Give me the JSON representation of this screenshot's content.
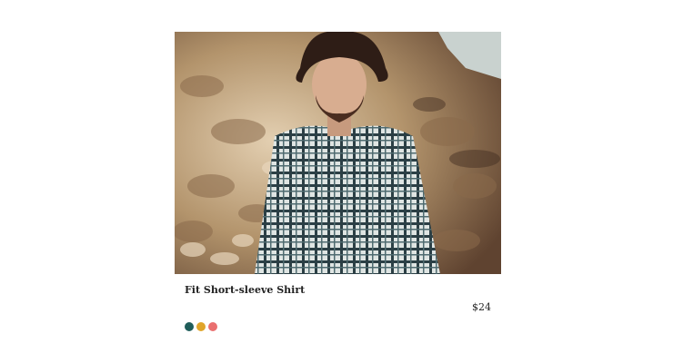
{
  "product": {
    "image_alt": "Young man with curly hair and beard wearing a plaid short-sleeve shirt, standing in front of a rocky cliff",
    "title": "Fit Short-sleeve Shirt",
    "price": "$24",
    "swatches": [
      {
        "name": "teal",
        "color": "#1f5d5a"
      },
      {
        "name": "mustard",
        "color": "#e0a52a"
      },
      {
        "name": "coral",
        "color": "#ea6f6f"
      }
    ]
  }
}
